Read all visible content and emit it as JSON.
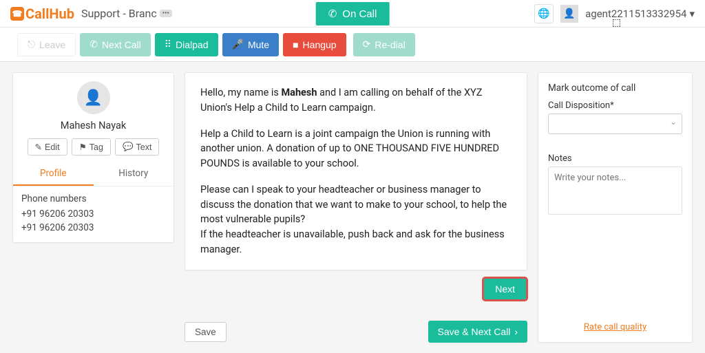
{
  "header": {
    "logo": "CallHub",
    "campaign": "Support - Branc",
    "on_call": "On Call",
    "username": "agent2211513332954"
  },
  "toolbar": {
    "leave": "Leave",
    "next_call": "Next Call",
    "dialpad": "Dialpad",
    "mute": "Mute",
    "hangup": "Hangup",
    "redial": "Re-dial"
  },
  "contact": {
    "name": "Mahesh Nayak",
    "edit": "Edit",
    "tag": "Tag",
    "text": "Text",
    "tabs": {
      "profile": "Profile",
      "history": "History"
    },
    "phone_header": "Phone numbers",
    "phones": [
      "+91 96206 20303",
      "+91 96206 20303"
    ]
  },
  "script": {
    "p1_pre": "Hello, my name is ",
    "p1_bold": "Mahesh",
    "p1_post": " and I am calling on behalf of the XYZ Union's Help a Child to Learn campaign.",
    "p2": "Help a Child to Learn is a joint campaign the Union is running with another union. A donation of up to ONE THOUSAND FIVE HUNDRED POUNDS is available to your school.",
    "p3a": "Please can I speak to your headteacher or business manager to discuss the donation that we want to make to your school, to help the most vulnerable pupils?",
    "p3b": "If the headteacher is unavailable, push back and ask for the business manager.",
    "next": "Next"
  },
  "footer": {
    "save": "Save",
    "save_next": "Save & Next Call"
  },
  "outcome": {
    "header": "Mark outcome of call",
    "disposition_label": "Call Disposition*",
    "notes_label": "Notes",
    "notes_placeholder": "Write your notes...",
    "rate_link": "Rate call quality"
  }
}
